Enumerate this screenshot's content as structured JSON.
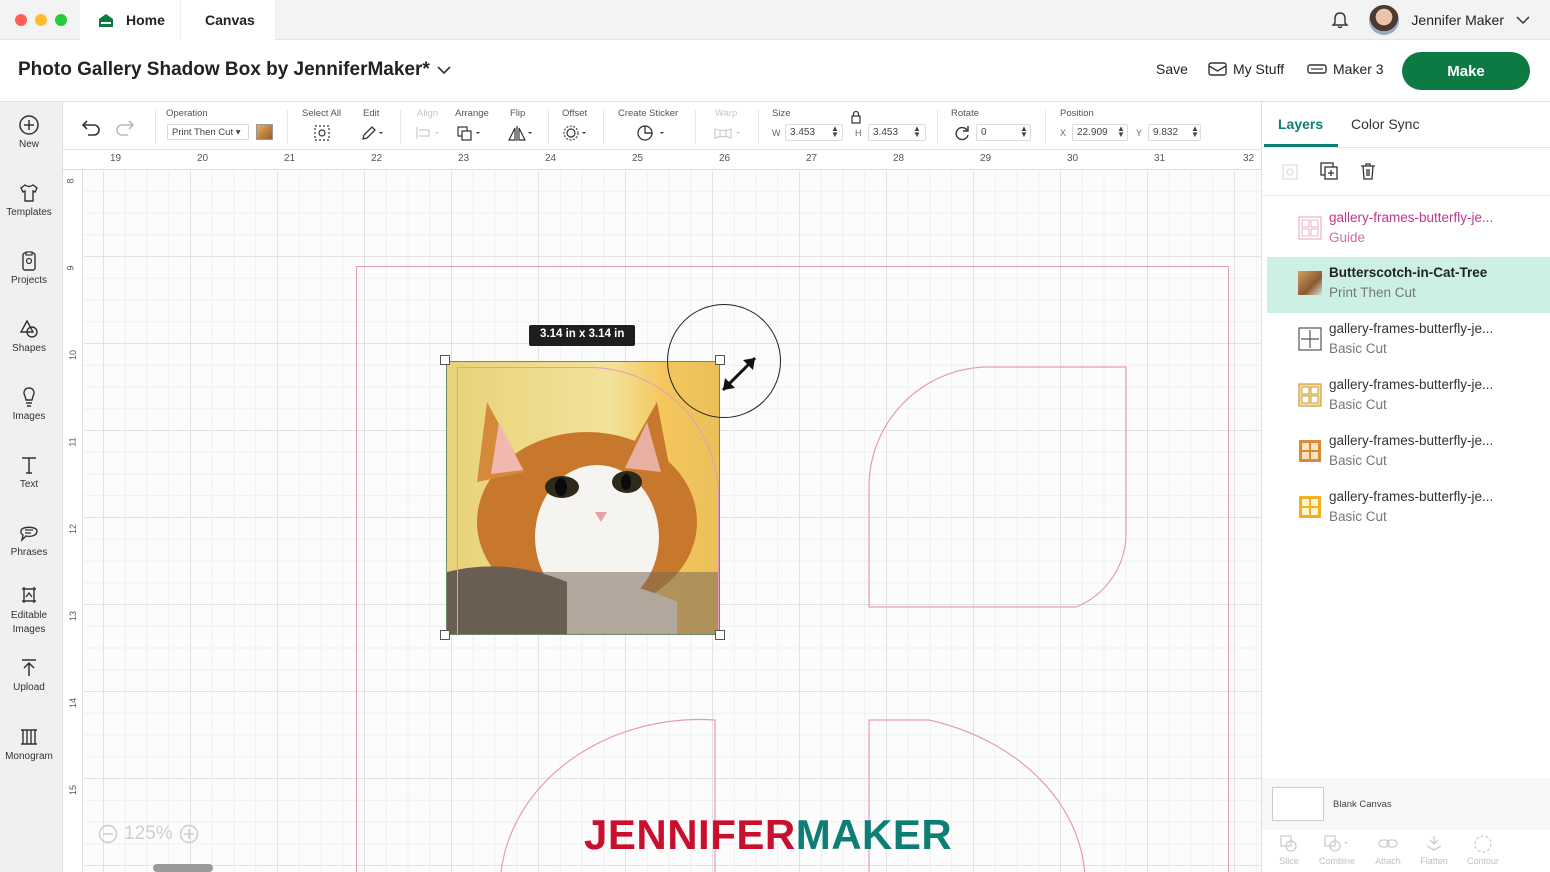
{
  "tabs": {
    "home": "Home",
    "canvas": "Canvas"
  },
  "user": {
    "name": "Jennifer Maker"
  },
  "project": {
    "title": "Photo Gallery Shadow Box by JenniferMaker*"
  },
  "header": {
    "save": "Save",
    "my_stuff": "My Stuff",
    "machine": "Maker 3",
    "make": "Make"
  },
  "leftbar": [
    {
      "label": "New",
      "icon": "plus-circle-icon"
    },
    {
      "label": "Templates",
      "icon": "shirt-icon"
    },
    {
      "label": "Projects",
      "icon": "clipboard-icon"
    },
    {
      "label": "Shapes",
      "icon": "shapes-icon"
    },
    {
      "label": "Images",
      "icon": "lightbulb-icon"
    },
    {
      "label": "Text",
      "icon": "text-t-icon"
    },
    {
      "label": "Phrases",
      "icon": "speech-bubble-icon"
    },
    {
      "label": "Editable Images",
      "icon": "editable-image-icon"
    },
    {
      "label": "Upload",
      "icon": "upload-icon"
    },
    {
      "label": "Monogram",
      "icon": "monogram-icon"
    }
  ],
  "toolbar": {
    "operation_label": "Operation",
    "operation_value": "Print Then Cut",
    "select_all": "Select All",
    "edit": "Edit",
    "align": "Align",
    "arrange": "Arrange",
    "flip": "Flip",
    "offset": "Offset",
    "create_sticker": "Create Sticker",
    "warp": "Warp",
    "size": "Size",
    "w_label": "W",
    "w_value": "3.453",
    "h_label": "H",
    "h_value": "3.453",
    "rotate": "Rotate",
    "rotate_value": "0",
    "position": "Position",
    "x_label": "X",
    "x_value": "22.909",
    "y_label": "Y",
    "y_value": "9.832"
  },
  "ruler": {
    "top": [
      "19",
      "20",
      "21",
      "22",
      "23",
      "24",
      "25",
      "26",
      "27",
      "28",
      "29",
      "30",
      "31",
      "32"
    ],
    "left": [
      "8",
      "9",
      "10",
      "11",
      "12",
      "13",
      "14",
      "15"
    ]
  },
  "canvas": {
    "size_tooltip": "3.14  in x 3.14  in",
    "zoom": "125%",
    "watermark_red": "JENNIFER",
    "watermark_teal": "MAKER"
  },
  "panel": {
    "tab_layers": "Layers",
    "tab_color_sync": "Color Sync",
    "layers": [
      {
        "name": "gallery-frames-butterfly-je...",
        "type": "Guide",
        "color": "#c0368a"
      },
      {
        "name": "Butterscotch-in-Cat-Tree",
        "type": "Print Then Cut",
        "selected": true
      },
      {
        "name": "gallery-frames-butterfly-je...",
        "type": "Basic Cut"
      },
      {
        "name": "gallery-frames-butterfly-je...",
        "type": "Basic Cut"
      },
      {
        "name": "gallery-frames-butterfly-je...",
        "type": "Basic Cut"
      },
      {
        "name": "gallery-frames-butterfly-je...",
        "type": "Basic Cut"
      }
    ],
    "blank_canvas": "Blank Canvas",
    "bottom_tools": [
      "Slice",
      "Combine",
      "Attach",
      "Flatten",
      "Contour"
    ]
  },
  "colors": {
    "make_green": "#0e7a43",
    "selected_layer": "#ccf0e6",
    "guide_pink": "#e59ac0",
    "accent_teal": "#0c7e74"
  }
}
